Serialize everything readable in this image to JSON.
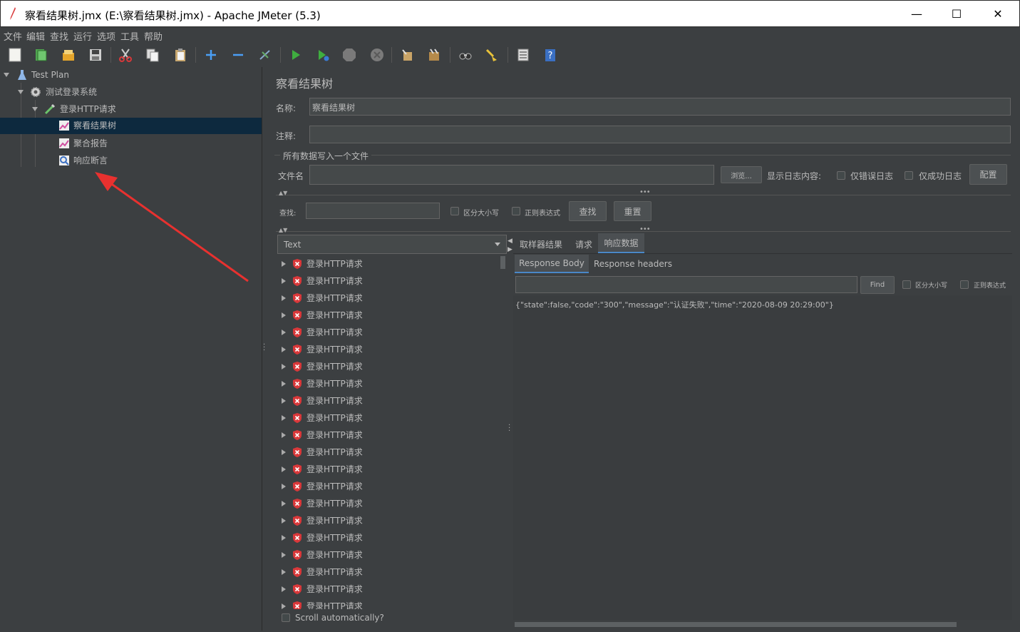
{
  "window": {
    "title": "察看结果树.jmx (E:\\察看结果树.jmx) - Apache JMeter (5.3)",
    "minimize": "—",
    "maximize": "☐",
    "close": "✕"
  },
  "menu": [
    "文件",
    "编辑",
    "查找",
    "运行",
    "选项",
    "工具",
    "帮助"
  ],
  "toolbar": {
    "icons": [
      "new-icon",
      "templates-icon",
      "open-icon",
      "save-icon",
      "cut-icon",
      "copy-icon",
      "paste-icon",
      "expand-icon",
      "collapse-icon",
      "toggle-icon",
      "start-icon",
      "start-no-pause-icon",
      "stop-icon",
      "shutdown-icon",
      "clear-icon",
      "clear-all-icon",
      "search-icon",
      "reset-search-icon",
      "function-helper-icon",
      "help-icon"
    ]
  },
  "tree": {
    "items": [
      {
        "label": "Test Plan",
        "icon": "flask-icon"
      },
      {
        "label": "测试登录系统",
        "icon": "gear-icon"
      },
      {
        "label": "登录HTTP请求",
        "icon": "pipette-icon"
      },
      {
        "label": "察看结果树",
        "icon": "chart-icon"
      },
      {
        "label": "聚合报告",
        "icon": "chart-icon"
      },
      {
        "label": "响应断言",
        "icon": "magnifier-icon"
      }
    ]
  },
  "panel": {
    "heading": "察看结果树",
    "name_label": "名称:",
    "name_value": "察看结果树",
    "comment_label": "注释:",
    "comment_value": "",
    "file_section": "所有数据写入一个文件",
    "filename_label": "文件名",
    "filename_value": "",
    "browse": "浏览...",
    "log_label": "显示日志内容:",
    "errors_only": "仅错误日志",
    "success_only": "仅成功日志",
    "configure": "配置",
    "search_label": "查找:",
    "search_value": "",
    "case_sensitive": "区分大小写",
    "regex": "正则表达式",
    "find_btn": "查找",
    "reset_btn": "重置"
  },
  "results": {
    "renderer": "Text",
    "item_label": "登录HTTP请求",
    "items": [
      "登录HTTP请求",
      "登录HTTP请求",
      "登录HTTP请求",
      "登录HTTP请求",
      "登录HTTP请求",
      "登录HTTP请求",
      "登录HTTP请求",
      "登录HTTP请求",
      "登录HTTP请求",
      "登录HTTP请求",
      "登录HTTP请求",
      "登录HTTP请求",
      "登录HTTP请求",
      "登录HTTP请求",
      "登录HTTP请求",
      "登录HTTP请求",
      "登录HTTP请求",
      "登录HTTP请求",
      "登录HTTP请求",
      "登录HTTP请求",
      "登录HTTP请求"
    ],
    "partial_item": "登录HTTP请求",
    "scroll_auto": "Scroll automatically?"
  },
  "detail": {
    "tabs": [
      "取样器结果",
      "请求",
      "响应数据"
    ],
    "active_tab": "响应数据",
    "subtabs": [
      "Response Body",
      "Response headers"
    ],
    "find_btn": "Find",
    "case_sensitive": "区分大小写",
    "regex": "正则表达式",
    "body": "{\"state\":false,\"code\":\"300\",\"message\":\"认证失败\",\"time\":\"2020-08-09 20:29:00\"}"
  },
  "colors": {
    "background": "#3c3f41",
    "selection": "#0d293e",
    "annotation_arrow": "#e8312f",
    "error_icon": "#d9383a"
  }
}
